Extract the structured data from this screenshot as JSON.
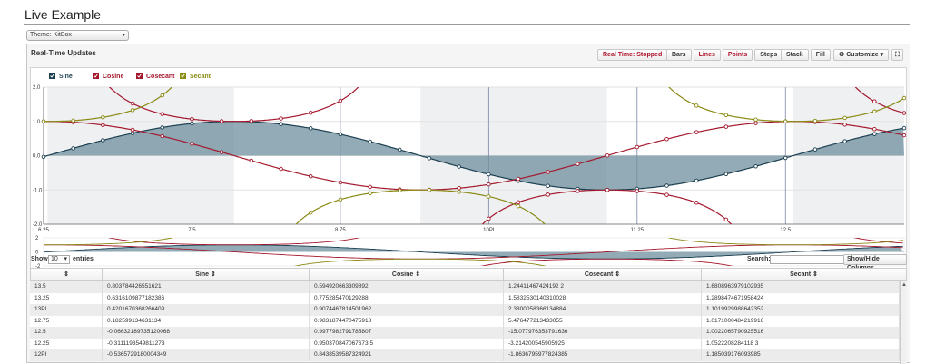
{
  "page": {
    "title": "Live Example"
  },
  "theme": {
    "label": "Theme: KitBox"
  },
  "panel": {
    "title": "Real-Time Updates"
  },
  "toolbar": {
    "realtime": "Real Time: Stopped",
    "bars": "Bars",
    "lines": "Lines",
    "points": "Points",
    "steps": "Steps",
    "stack": "Stack",
    "fill": "Fill",
    "customize": "Customize",
    "fullscreen": "⛶"
  },
  "legend": [
    {
      "name": "Sine",
      "color": "#1c3f50"
    },
    {
      "name": "Cosine",
      "color": "#a4182d"
    },
    {
      "name": "Cosecant",
      "color": "#a4182d"
    },
    {
      "name": "Secant",
      "color": "#8a8a14"
    }
  ],
  "chart_data": {
    "type": "line",
    "xlim": [
      6.25,
      13.5
    ],
    "ylim": [
      -2,
      2
    ],
    "y_ticks": [
      "2.0",
      "1.0",
      "0.0",
      "-1.0",
      "-2.0"
    ],
    "x_ticks": [
      "6.25",
      "7.5",
      "8.75",
      "10PI",
      "11.25",
      "12.5"
    ],
    "x_tick_values": [
      6.25,
      7.5,
      8.75,
      10,
      11.25,
      12.5
    ],
    "overview_y_ticks": [
      "2",
      "0",
      "-2"
    ],
    "series": [
      {
        "name": "Sine",
        "color": "#1c3f50",
        "fill": true
      },
      {
        "name": "Cosine",
        "color": "#a4182d"
      },
      {
        "name": "Cosecant",
        "color": "#a4182d"
      },
      {
        "name": "Secant",
        "color": "#8a8a14"
      }
    ],
    "x": [
      6.25,
      6.5,
      6.75,
      7,
      7.25,
      7.5,
      7.75,
      8,
      8.25,
      8.5,
      8.75,
      9,
      9.25,
      9.5,
      9.75,
      10,
      10.25,
      10.5,
      10.75,
      11,
      11.25,
      11.5,
      11.75,
      12,
      12.25,
      12.5,
      12.75,
      13,
      13.25,
      13.5
    ]
  },
  "table": {
    "show_label": "Show",
    "entries_value": "10",
    "entries_label": "entries",
    "search_label": "Search:",
    "search_value": "",
    "columns_button": "Show/Hide Columns",
    "headers": [
      "⇕",
      "Sine ⇕",
      "Cosine ⇕",
      "Cosecant ⇕",
      "Secant ⇕"
    ],
    "rows": [
      [
        "13.5",
        "0.803784426551621",
        "0.594920663309892",
        "1.24411467424192 2",
        "1.6808963979102935"
      ],
      [
        "13.25",
        "0.6316109877182386",
        "0.775285470129288",
        "1.5832530140310028",
        "1.2898474671958424"
      ],
      [
        "13PI",
        "0.4201670368266409",
        "0.9074467814501962",
        "2.3800058366134884",
        "1.1019929988642352"
      ],
      [
        "12.75",
        "0.182599134631134",
        "0.9831874470475918",
        "5.476477213433055",
        "1.0171000484219916"
      ],
      [
        "12.5",
        "-0.06632189735120068",
        "0.9977982791785807",
        "-15.077976353791636",
        "1.0022065790925516"
      ],
      [
        "12.25",
        "-0.3111193549811273",
        "0.950370847067673 5",
        "-3.214200545905925",
        "1.0522208284118 3"
      ],
      [
        "12PI",
        "-0.5365729180004349",
        "0.8438539587324921",
        "-1.8636795977824385",
        "1.185039176093985"
      ]
    ]
  }
}
